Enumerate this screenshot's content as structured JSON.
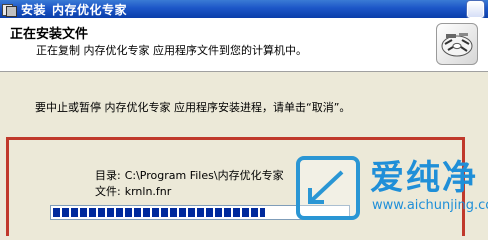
{
  "window": {
    "title_prefix": "安装",
    "title_app": "内存优化专家"
  },
  "header": {
    "title": "正在安装文件",
    "subtitle": "正在复制 内存优化专家 应用程序文件到您的计算机中。",
    "logo_icon": "install-disc-icon"
  },
  "notice": "要中止或暂停 内存优化专家 应用程序安装进程，请单击“取消”。",
  "status": {
    "dir_label": "目录:",
    "dir_value": "C:\\Program Files\\内存优化专家",
    "file_label": "文件:",
    "file_value": "krnln.fnr",
    "progress_fraction": 0.72
  },
  "watermark": {
    "name": "爱纯净",
    "url": "www.aichunjing.com"
  },
  "colors": {
    "titlebar": "#0a3ea9",
    "progress_block": "#002a9c",
    "highlight_border": "#c0392b",
    "watermark": "#1f8fd8"
  }
}
